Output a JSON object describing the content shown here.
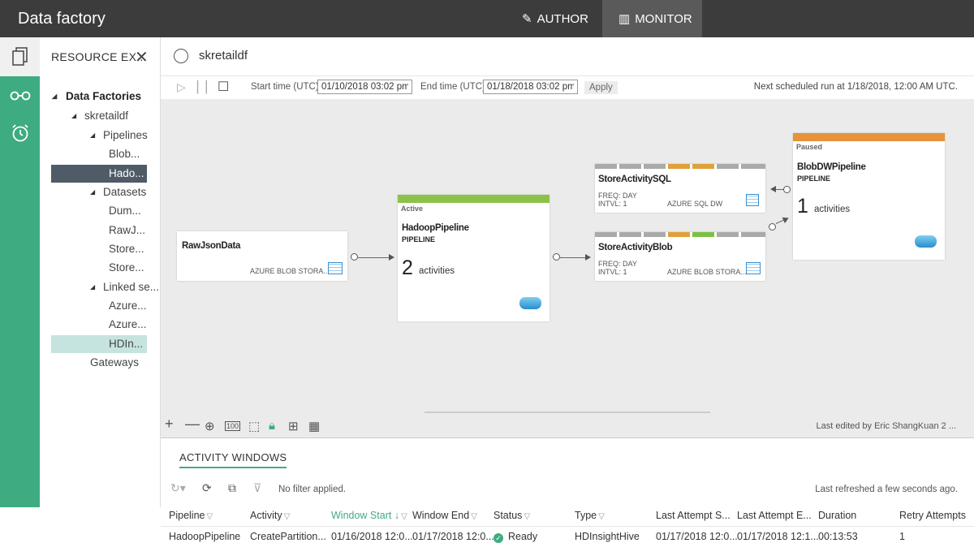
{
  "app": {
    "title": "Data factory"
  },
  "top_tabs": {
    "author": "AUTHOR",
    "monitor": "MONITOR"
  },
  "explorer": {
    "header": "RESOURCE EX...",
    "tree": {
      "root": "Data Factories",
      "factory": "skretaildf",
      "pipelines": "Pipelines",
      "pipeline_items": [
        "Blob...",
        "Hado..."
      ],
      "datasets": "Datasets",
      "dataset_items": [
        "Dum...",
        "RawJ...",
        "Store...",
        "Store..."
      ],
      "linked": "Linked se...",
      "linked_items": [
        "Azure...",
        "Azure...",
        "HDIn..."
      ],
      "gateways": "Gateways"
    }
  },
  "main": {
    "title": "skretaildf"
  },
  "toolbar": {
    "start_label": "Start time (UTC):",
    "start_value": "01/10/2018 03:02 pm",
    "end_label": "End time (UTC):",
    "end_value": "01/18/2018 03:02 pm",
    "apply": "Apply",
    "next_run": "Next scheduled run at 1/18/2018, 12:00 AM UTC."
  },
  "diagram": {
    "raw_json": {
      "title": "RawJsonData",
      "type": "AZURE BLOB STORA..."
    },
    "hadoop": {
      "status": "Active",
      "title": "HadoopPipeline",
      "subtitle": "PIPELINE",
      "count": "2",
      "activities": "activities",
      "status_color": "#8bc34a"
    },
    "store_sql": {
      "title": "StoreActivitySQL",
      "freq": "FREQ: DAY",
      "intvl": "INTVL: 1",
      "type": "AZURE SQL DW"
    },
    "store_blob": {
      "title": "StoreActivityBlob",
      "freq": "FREQ: DAY",
      "intvl": "INTVL: 1",
      "type": "AZURE BLOB STORA..."
    },
    "blob_dw": {
      "status": "Paused",
      "title": "BlobDWPipeline",
      "subtitle": "PIPELINE",
      "count": "1",
      "activities": "activities",
      "status_color": "#e8923a"
    }
  },
  "canvas_footer": {
    "last_edited": "Last edited by Eric ShangKuan 2 ..."
  },
  "activity_windows": {
    "tab": "ACTIVITY WINDOWS",
    "no_filter": "No filter applied.",
    "refreshed": "Last refreshed a few seconds ago.",
    "columns": [
      "Pipeline",
      "Activity",
      "Window Start",
      "Window End",
      "Status",
      "Type",
      "Last Attempt S...",
      "Last Attempt E...",
      "Duration",
      "Retry Attempts"
    ],
    "sort_arrow": "↓",
    "rows": [
      {
        "pipeline": "HadoopPipeline",
        "activity": "CreatePartition...",
        "window_start": "01/16/2018 12:0...",
        "window_end": "01/17/2018 12:0...",
        "status": "Ready",
        "type": "HDInsightHive",
        "last_start": "01/17/2018 12:0...",
        "last_end": "01/17/2018 12:1...",
        "duration": "00:13:53",
        "retry": "1"
      }
    ]
  },
  "colors": {
    "accent": "#3fab80",
    "topbar": "#3c3c3c",
    "selected_tree": "#4f5b66"
  }
}
